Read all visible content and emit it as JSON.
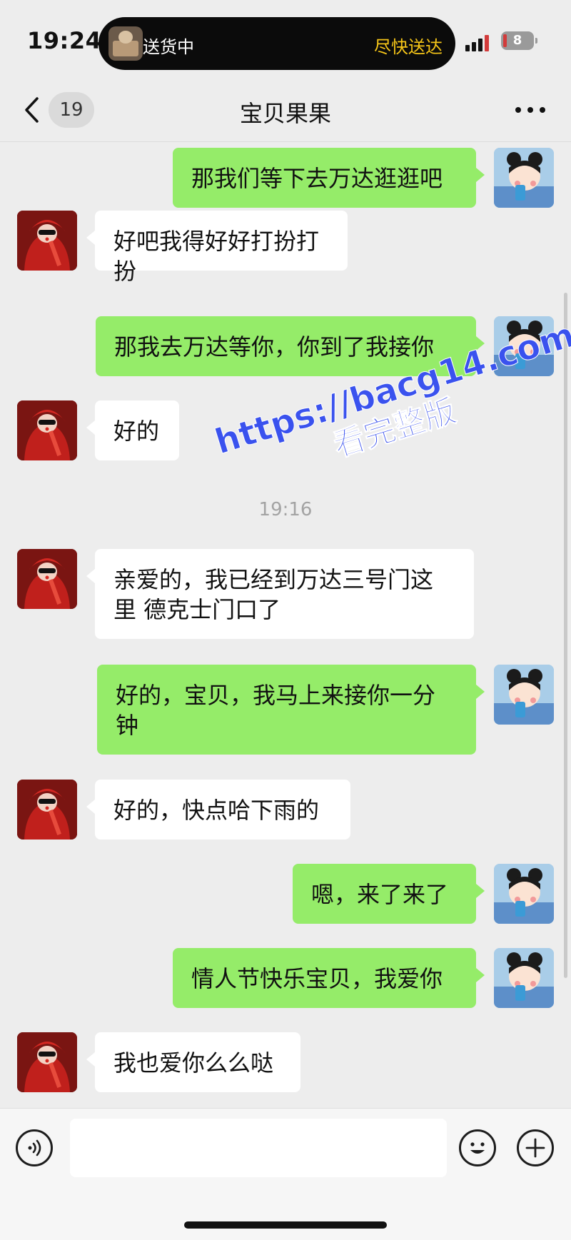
{
  "status_bar": {
    "time": "19:24",
    "activity": {
      "left_text": "送货中",
      "right_text": "尽快送达"
    },
    "battery": "8"
  },
  "nav": {
    "unread_count": "19",
    "title": "宝贝果果"
  },
  "messages": [
    {
      "from": "me",
      "text": "那我们等下去万达逛逛吧"
    },
    {
      "from": "them",
      "text": "好吧我得好好打扮打扮"
    },
    {
      "from": "me",
      "text": "那我去万达等你，你到了我接你"
    },
    {
      "from": "them",
      "text": "好的"
    },
    {
      "type": "time",
      "text": "19:16"
    },
    {
      "from": "them",
      "text": "亲爱的，我已经到万达三号门这里 德克士门口了"
    },
    {
      "from": "me",
      "text": "好的，宝贝，我马上来接你一分钟"
    },
    {
      "from": "them",
      "text": "好的，快点哈下雨的"
    },
    {
      "from": "me",
      "text": "嗯，来了来了"
    },
    {
      "from": "me",
      "text": "情人节快乐宝贝，我爱你"
    },
    {
      "from": "them",
      "text": "我也爱你么么哒"
    }
  ],
  "watermark": {
    "line1": "https://bacg14.com",
    "line2": "看完整版"
  },
  "input": {
    "value": "",
    "placeholder": ""
  },
  "icons": {
    "back": "chevron-left-icon",
    "more": "more-dots-icon",
    "voice": "voice-icon",
    "emoji": "emoji-icon",
    "add": "plus-icon"
  },
  "colors": {
    "background": "#ededed",
    "my_bubble": "#95ec69",
    "their_bubble": "#ffffff",
    "activity_accent": "#f5c518",
    "watermark": "#3a52ee"
  }
}
